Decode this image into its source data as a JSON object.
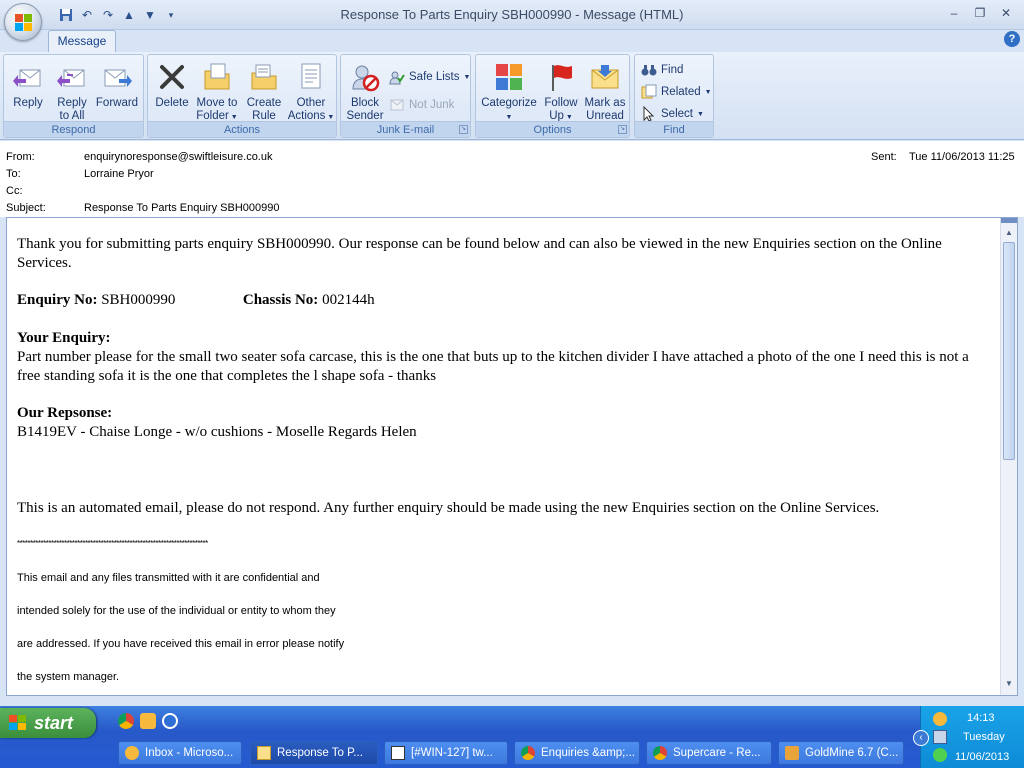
{
  "window": {
    "title": "Response To Parts Enquiry SBH000990 - Message (HTML)",
    "controls": [
      "–",
      "❐",
      "✕"
    ]
  },
  "tabs": [
    {
      "label": "Message"
    }
  ],
  "help_label": "?",
  "ribbon": {
    "respond": {
      "label": "Respond",
      "reply": "Reply",
      "reply_all_1": "Reply",
      "reply_all_2": "to All",
      "forward": "Forward"
    },
    "actions": {
      "label": "Actions",
      "delete": "Delete",
      "move_1": "Move to",
      "move_2": "Folder",
      "create_1": "Create",
      "create_2": "Rule",
      "other_1": "Other",
      "other_2": "Actions"
    },
    "junk": {
      "label": "Junk E-mail",
      "block_1": "Block",
      "block_2": "Sender",
      "safe_lists": "Safe Lists",
      "not_junk": "Not Junk"
    },
    "options": {
      "label": "Options",
      "categorize": "Categorize",
      "follow_1": "Follow",
      "follow_2": "Up",
      "mark_1": "Mark as",
      "mark_2": "Unread"
    },
    "find": {
      "label": "Find",
      "find": "Find",
      "related": "Related",
      "select": "Select"
    }
  },
  "header": {
    "from_label": "From:",
    "from": "enquirynoresponse@swiftleisure.co.uk",
    "to_label": "To:",
    "to": "Lorraine Pryor",
    "cc_label": "Cc:",
    "cc": "",
    "subject_label": "Subject:",
    "subject": "Response To Parts Enquiry SBH000990",
    "sent_label": "Sent:",
    "sent": "Tue 11/06/2013 11:25"
  },
  "body": {
    "intro": "Thank you for submitting parts enquiry SBH000990. Our response can be found below and can also be viewed in the new Enquiries section on the Online Services.",
    "enquiry_no_label": "Enquiry No:",
    "enquiry_no": "SBH000990",
    "chassis_no_label": "Chassis No:",
    "chassis_no": "002144h",
    "your_enquiry_label": "Your Enquiry:",
    "your_enquiry": "Part number please for the small two seater sofa carcase, this is the one that buts up to the kitchen divider I have attached a photo of the one I need this is not a free standing sofa it is the one that completes the l shape sofa - thanks",
    "our_response_label": "Our Repsonse:",
    "our_response": "B1419EV - Chaise Longe - w/o cushions - Moselle Regards Helen",
    "automated": "This is an automated email, please do not respond. Any further enquiry should be made using the new Enquiries section on the Online Services.",
    "separator": "*************************************************************************",
    "disclaimer": [
      "This email and any files transmitted with it are confidential and",
      "intended solely for the use of the individual or entity to whom they",
      "are addressed. If you have received this email in error please notify",
      "the system manager."
    ]
  },
  "taskbar": {
    "start": "start",
    "tasks": [
      {
        "label": "Inbox - Microso...",
        "icon": "outlook-icon"
      },
      {
        "label": "Response To P...",
        "icon": "email-icon"
      },
      {
        "label": "[#WIN-127] tw...",
        "icon": "tracker-icon"
      },
      {
        "label": "Enquiries &amp;...",
        "icon": "chrome-icon"
      },
      {
        "label": "Supercare - Re...",
        "icon": "chrome-icon"
      },
      {
        "label": "GoldMine 6.7 (C...",
        "icon": "goldmine-icon"
      }
    ],
    "clock": {
      "time": "14:13",
      "day": "Tuesday",
      "date": "11/06/2013"
    }
  }
}
